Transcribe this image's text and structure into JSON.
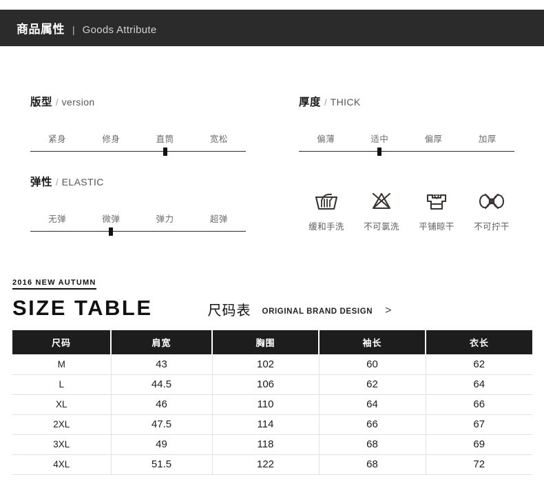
{
  "header": {
    "title_cn": "商品属性",
    "divider": "|",
    "title_en": "Goods Attribute",
    "bar_color": "#2b2b2b"
  },
  "attributes": [
    {
      "name": "version",
      "title_cn": "版型",
      "separator": "/",
      "title_en": "version",
      "labels": [
        "紧身",
        "修身",
        "直筒",
        "宽松"
      ],
      "selected_index": 2,
      "selected_label": "直筒"
    },
    {
      "name": "thickness",
      "title_cn": "厚度",
      "separator": "/",
      "title_en": "THICK",
      "labels": [
        "偏薄",
        "适中",
        "偏厚",
        "加厚"
      ],
      "selected_index": 1,
      "selected_label": "适中"
    },
    {
      "name": "elastic",
      "title_cn": "弹性",
      "separator": "/",
      "title_en": "ELASTIC",
      "labels": [
        "无弹",
        "微弹",
        "弹力",
        "超弹"
      ],
      "selected_index": 1,
      "selected_label": "微弹"
    }
  ],
  "care_instructions": [
    {
      "icon": "hand-wash-icon",
      "label": "缓和手洗"
    },
    {
      "icon": "no-bleach-icon",
      "label": "不可氯洗"
    },
    {
      "icon": "flat-dry-icon",
      "label": "平铺晾干"
    },
    {
      "icon": "no-wring-icon",
      "label": "不可拧干"
    }
  ],
  "size_section": {
    "season_tag": "2016 NEW AUTUMN",
    "title_en": "SIZE TABLE",
    "title_cn": "尺码表",
    "subtitle_en": "ORIGINAL BRAND DESIGN",
    "chevron": ">"
  },
  "size_table": {
    "columns": [
      "尺码",
      "肩宽",
      "胸围",
      "袖长",
      "衣长"
    ],
    "rows": [
      [
        "M",
        "43",
        "102",
        "60",
        "62"
      ],
      [
        "L",
        "44.5",
        "106",
        "62",
        "64"
      ],
      [
        "XL",
        "46",
        "110",
        "64",
        "66"
      ],
      [
        "2XL",
        "47.5",
        "114",
        "66",
        "67"
      ],
      [
        "3XL",
        "49",
        "118",
        "68",
        "69"
      ],
      [
        "4XL",
        "51.5",
        "122",
        "68",
        "72"
      ]
    ]
  }
}
